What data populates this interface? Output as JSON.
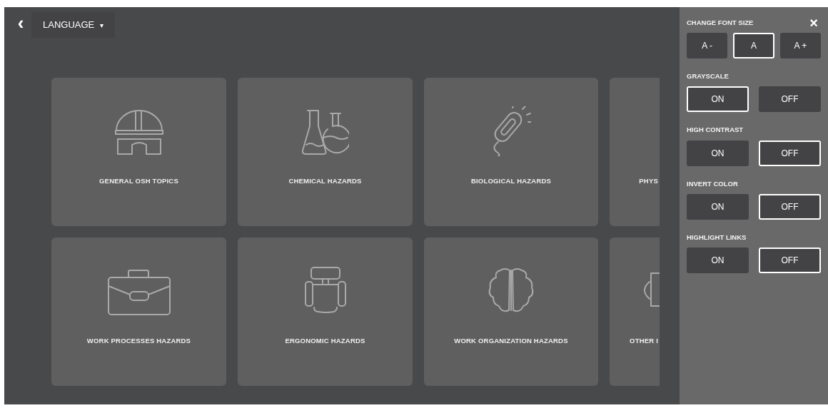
{
  "top_bar": {
    "back": "‹",
    "language": {
      "label": "LANGUAGE",
      "caret": "▾"
    }
  },
  "topics": [
    {
      "label": "GENERAL OSH TOPICS"
    },
    {
      "label": "CHEMICAL HAZARDS"
    },
    {
      "label": "BIOLOGICAL HAZARDS"
    },
    {
      "label": "PHYS"
    },
    {
      "label": "WORK PROCESSES HAZARDS"
    },
    {
      "label": "ERGONOMIC HAZARDS"
    },
    {
      "label": "WORK ORGANIZATION HAZARDS"
    },
    {
      "label": "OTHER I"
    }
  ],
  "accessibility_panel": {
    "close": "×",
    "font_size": {
      "title": "CHANGE FONT SIZE",
      "options": [
        {
          "label": "A -",
          "selected": false
        },
        {
          "label": "A",
          "selected": true
        },
        {
          "label": "A +",
          "selected": false
        }
      ]
    },
    "toggles": [
      {
        "title": "GRAYSCALE",
        "options": [
          {
            "label": "ON",
            "selected": true
          },
          {
            "label": "OFF",
            "selected": false
          }
        ]
      },
      {
        "title": "HIGH CONTRAST",
        "options": [
          {
            "label": "ON",
            "selected": false
          },
          {
            "label": "OFF",
            "selected": true
          }
        ]
      },
      {
        "title": "INVERT COLOR",
        "options": [
          {
            "label": "ON",
            "selected": false
          },
          {
            "label": "OFF",
            "selected": true
          }
        ]
      },
      {
        "title": "HIGHLIGHT LINKS",
        "options": [
          {
            "label": "ON",
            "selected": false
          },
          {
            "label": "OFF",
            "selected": true
          }
        ]
      }
    ]
  }
}
